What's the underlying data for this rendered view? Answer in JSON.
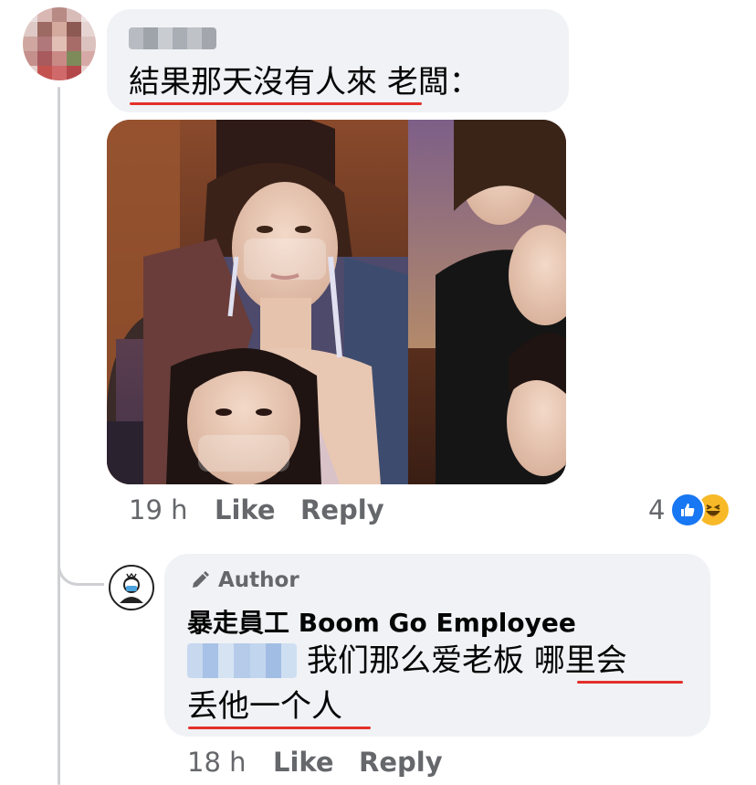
{
  "comment": {
    "commenter_name": "",
    "text_underlined": "結果那天沒有人來",
    "text_rest": "老闆：",
    "time": "19 h",
    "like_label": "Like",
    "reply_label": "Reply",
    "reaction_count": "4",
    "reactions": [
      "like-icon",
      "haha-icon"
    ]
  },
  "reply": {
    "badge_label": "Author",
    "author_name": "暴走員工 Boom Go Employee",
    "mentioned_name": "",
    "text_part1": "我们那么爱老板",
    "text_part2_underlined": "哪里会",
    "text_line2_underlined": "丢他一个人",
    "time": "18 h",
    "like_label": "Like",
    "reply_label": "Reply"
  },
  "colors": {
    "underline": "#e4302b",
    "bubble": "#f0f2f5",
    "meta_text": "#65676b",
    "like_blue": "#1877f2",
    "haha_yellow": "#f7b928"
  }
}
